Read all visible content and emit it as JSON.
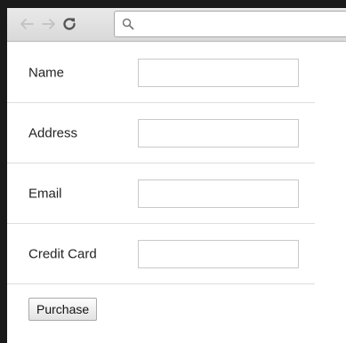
{
  "browser": {
    "back_icon": "arrow-left-icon",
    "forward_icon": "arrow-right-icon",
    "reload_icon": "reload-icon",
    "search_icon": "magnifier-icon",
    "omnibox_value": "",
    "colors": {
      "disabled_arrow": "#c2c2c2",
      "reload": "#555555"
    }
  },
  "form": {
    "fields": [
      {
        "label": "Name",
        "value": ""
      },
      {
        "label": "Address",
        "value": ""
      },
      {
        "label": "Email",
        "value": ""
      },
      {
        "label": "Credit Card",
        "value": ""
      }
    ],
    "submit_label": "Purchase"
  }
}
